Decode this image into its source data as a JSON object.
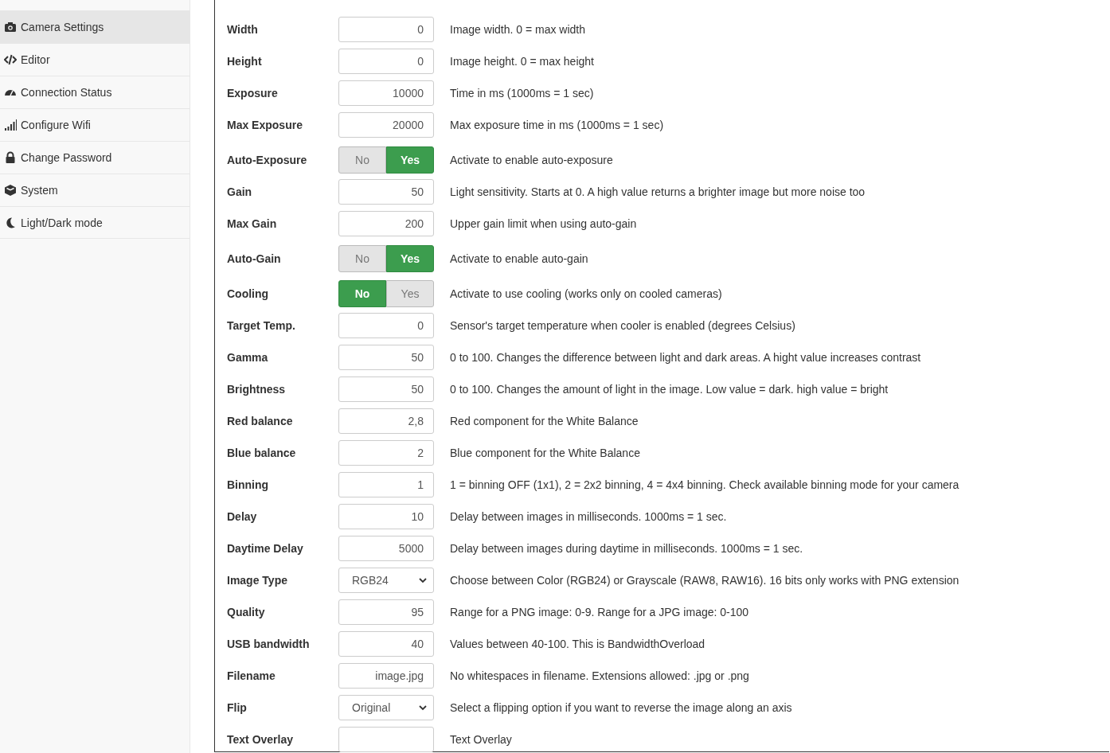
{
  "sidebar": {
    "items": [
      {
        "label": "Camera Settings",
        "selected": true
      },
      {
        "label": "Editor",
        "selected": false
      },
      {
        "label": "Connection Status",
        "selected": false
      },
      {
        "label": "Configure Wifi",
        "selected": false
      },
      {
        "label": "Change Password",
        "selected": false
      },
      {
        "label": "System",
        "selected": false
      },
      {
        "label": "Light/Dark mode",
        "selected": false
      }
    ]
  },
  "settings": [
    {
      "kind": "input",
      "label": "Width",
      "value": "0",
      "description": "Image width. 0 = max width"
    },
    {
      "kind": "input",
      "label": "Height",
      "value": "0",
      "description": "Image height. 0 = max height"
    },
    {
      "kind": "input",
      "label": "Exposure",
      "value": "10000",
      "description": "Time in ms (1000ms = 1 sec)"
    },
    {
      "kind": "input",
      "label": "Max Exposure",
      "value": "20000",
      "description": "Max exposure time in ms (1000ms = 1 sec)"
    },
    {
      "kind": "toggle",
      "label": "Auto-Exposure",
      "options": [
        {
          "label": "No",
          "selected": false
        },
        {
          "label": "Yes",
          "selected": true
        }
      ],
      "description": "Activate to enable auto-exposure"
    },
    {
      "kind": "input",
      "label": "Gain",
      "value": "50",
      "description": "Light sensitivity. Starts at 0. A high value returns a brighter image but more noise too"
    },
    {
      "kind": "input",
      "label": "Max Gain",
      "value": "200",
      "description": "Upper gain limit when using auto-gain"
    },
    {
      "kind": "toggle",
      "label": "Auto-Gain",
      "options": [
        {
          "label": "No",
          "selected": false
        },
        {
          "label": "Yes",
          "selected": true
        }
      ],
      "description": "Activate to enable auto-gain"
    },
    {
      "kind": "toggle",
      "label": "Cooling",
      "options": [
        {
          "label": "No",
          "selected": true
        },
        {
          "label": "Yes",
          "selected": false
        }
      ],
      "description": "Activate to use cooling (works only on cooled cameras)"
    },
    {
      "kind": "input",
      "label": "Target Temp.",
      "value": "0",
      "description": "Sensor's target temperature when cooler is enabled (degrees Celsius)"
    },
    {
      "kind": "input",
      "label": "Gamma",
      "value": "50",
      "description": "0 to 100. Changes the difference between light and dark areas. A hight value increases contrast"
    },
    {
      "kind": "input",
      "label": "Brightness",
      "value": "50",
      "description": "0 to 100. Changes the amount of light in the image. Low value = dark. high value = bright"
    },
    {
      "kind": "input",
      "label": "Red balance",
      "value": "2,8",
      "description": "Red component for the White Balance"
    },
    {
      "kind": "input",
      "label": "Blue balance",
      "value": "2",
      "description": "Blue component for the White Balance"
    },
    {
      "kind": "input",
      "label": "Binning",
      "value": "1",
      "description": "1 = binning OFF (1x1), 2 = 2x2 binning, 4 = 4x4 binning. Check available binning mode for your camera"
    },
    {
      "kind": "input",
      "label": "Delay",
      "value": "10",
      "description": "Delay between images in milliseconds. 1000ms = 1 sec."
    },
    {
      "kind": "input",
      "label": "Daytime Delay",
      "value": "5000",
      "description": "Delay between images during daytime in milliseconds. 1000ms = 1 sec."
    },
    {
      "kind": "select",
      "label": "Image Type",
      "value": "RGB24",
      "description": "Choose between Color (RGB24) or Grayscale (RAW8, RAW16). 16 bits only works with PNG extension"
    },
    {
      "kind": "input",
      "label": "Quality",
      "value": "95",
      "description": "Range for a PNG image: 0-9. Range for a JPG image: 0-100"
    },
    {
      "kind": "input",
      "label": "USB bandwidth",
      "value": "40",
      "description": "Values between 40-100. This is BandwidthOverload"
    },
    {
      "kind": "input",
      "label": "Filename",
      "value": "image.jpg",
      "description": "No whitespaces in filename. Extensions allowed: .jpg or .png"
    },
    {
      "kind": "select",
      "label": "Flip",
      "value": "Original",
      "description": "Select a flipping option if you want to reverse the image along an axis"
    },
    {
      "kind": "input",
      "label": "Text Overlay",
      "description": "Text Overlay"
    }
  ]
}
